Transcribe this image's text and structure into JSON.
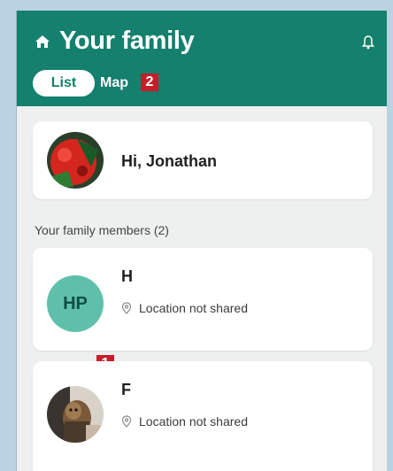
{
  "header": {
    "title": "Your family",
    "tabs": [
      {
        "label": "List",
        "selected": true
      },
      {
        "label": "Map",
        "selected": false
      }
    ],
    "icons": {
      "left": "home-icon",
      "right": "bell-icon"
    }
  },
  "annotations": {
    "badge_1": "1",
    "badge_2": "2"
  },
  "greeting": {
    "text": "Hi, Jonathan",
    "avatar": "profile-photo"
  },
  "members_section": {
    "label": "Your family members (2)"
  },
  "members": [
    {
      "name": "H",
      "initials": "HP",
      "location": "Location not shared"
    },
    {
      "name": "F",
      "avatar": "profile-photo",
      "location": "Location not shared"
    }
  ],
  "colors": {
    "primary": "#14806d",
    "initials_bg": "#5ec0aa",
    "badge": "#c21f2b",
    "background": "#eef0f0"
  }
}
